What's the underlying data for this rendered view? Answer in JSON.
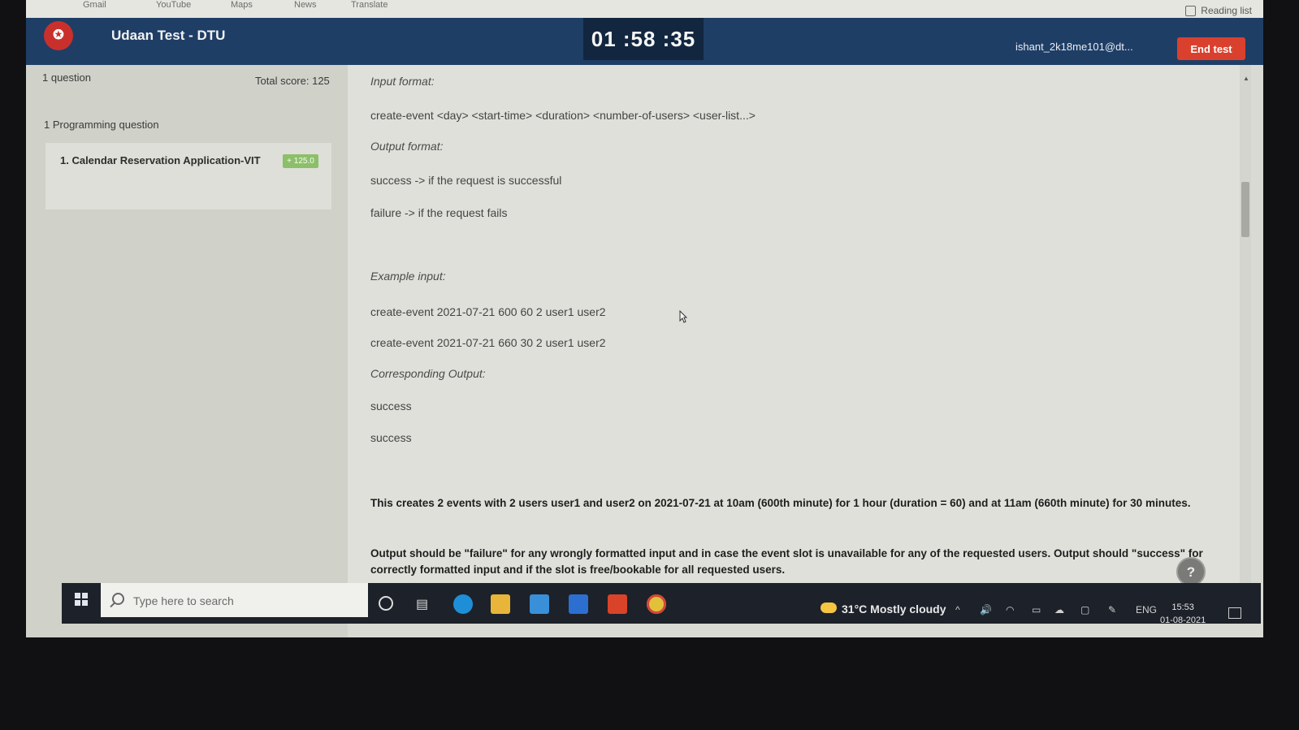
{
  "browser": {
    "bookmarks": [
      "Gmail",
      "YouTube",
      "Maps",
      "News",
      "Translate"
    ],
    "reading_list": "Reading list"
  },
  "header": {
    "title": "Udaan Test - DTU",
    "timer": "01 :58 :35",
    "user": "ishant_2k18me101@dt...",
    "end_test": "End test"
  },
  "sidebar": {
    "question_count": "1 question",
    "total_score": "Total score: 125",
    "section_heading": "1 Programming question",
    "questions": [
      {
        "label": "1.  Calendar Reservation Application-VIT",
        "score": "+ 125.0"
      }
    ]
  },
  "content": {
    "input_format_label": "Input format:",
    "input_format": "create-event <day> <start-time> <duration> <number-of-users> <user-list...>",
    "output_format_label": "Output format:",
    "output_success": "success -> if the request is successful",
    "output_failure": "failure -> if the request fails",
    "example_input_label": "Example input:",
    "example_inputs": [
      "create-event 2021-07-21 600 60 2 user1 user2",
      "create-event 2021-07-21 660 30 2 user1 user2"
    ],
    "corresponding_output_label": "Corresponding Output:",
    "outputs": [
      "success",
      "success"
    ],
    "paragraph1": "This creates 2 events with 2 users user1 and user2 on 2021-07-21 at 10am (600th minute) for 1 hour (duration = 60) and at 11am (660th minute) for 30 minutes.",
    "paragraph2": "Output should be \"failure\" for any wrongly formatted input and in case the event slot is unavailable for any of the requested users. Output should \"success\" for correctly formatted input and if the slot is free/bookable for all requested users.",
    "help": "?"
  },
  "taskbar": {
    "search_placeholder": "Type here to search",
    "weather": "31°C  Mostly cloudy",
    "language": "ENG",
    "time": "15:53",
    "date": "01-08-2021"
  },
  "colors": {
    "header_bg": "#1f3e66",
    "end_test_bg": "#d9412e",
    "score_badge": "#8cbf6a"
  }
}
